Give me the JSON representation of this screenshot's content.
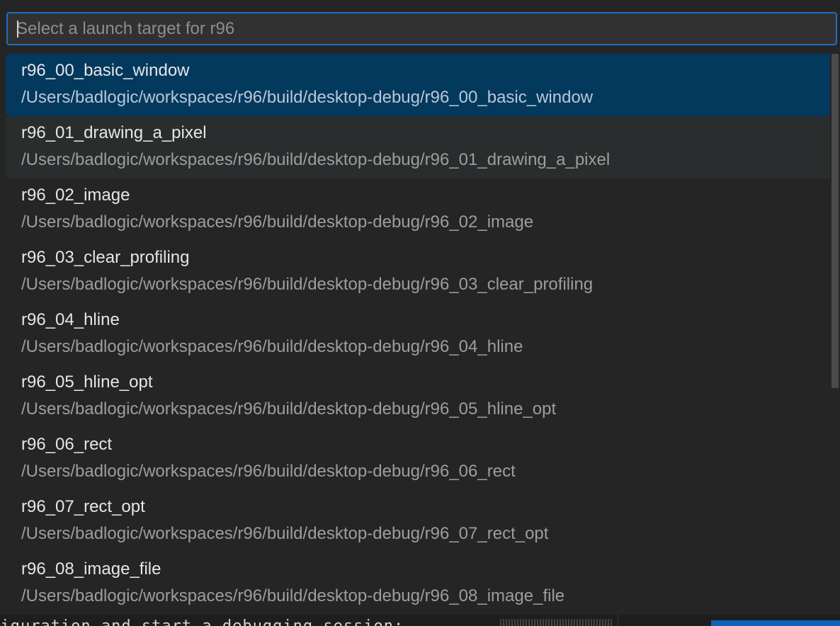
{
  "quick_pick": {
    "input": {
      "value": "",
      "placeholder": "Select a launch target for r96"
    },
    "items": [
      {
        "label": "r96_00_basic_window",
        "description": "/Users/badlogic/workspaces/r96/build/desktop-debug/r96_00_basic_window",
        "state": "selected"
      },
      {
        "label": "r96_01_drawing_a_pixel",
        "description": "/Users/badlogic/workspaces/r96/build/desktop-debug/r96_01_drawing_a_pixel",
        "state": "hover"
      },
      {
        "label": "r96_02_image",
        "description": "/Users/badlogic/workspaces/r96/build/desktop-debug/r96_02_image",
        "state": "normal"
      },
      {
        "label": "r96_03_clear_profiling",
        "description": "/Users/badlogic/workspaces/r96/build/desktop-debug/r96_03_clear_profiling",
        "state": "normal"
      },
      {
        "label": "r96_04_hline",
        "description": "/Users/badlogic/workspaces/r96/build/desktop-debug/r96_04_hline",
        "state": "normal"
      },
      {
        "label": "r96_05_hline_opt",
        "description": "/Users/badlogic/workspaces/r96/build/desktop-debug/r96_05_hline_opt",
        "state": "normal"
      },
      {
        "label": "r96_06_rect",
        "description": "/Users/badlogic/workspaces/r96/build/desktop-debug/r96_06_rect",
        "state": "normal"
      },
      {
        "label": "r96_07_rect_opt",
        "description": "/Users/badlogic/workspaces/r96/build/desktop-debug/r96_07_rect_opt",
        "state": "normal"
      },
      {
        "label": "r96_08_image_file",
        "description": "/Users/badlogic/workspaces/r96/build/desktop-debug/r96_08_image_file",
        "state": "normal"
      }
    ]
  },
  "editor_background": {
    "text": "nfiguration and start a debugging session:"
  },
  "colors": {
    "accent_border": "#1f6fc5",
    "selected_bg": "#04395e",
    "hover_bg": "#2a2d2e",
    "panel_bg": "#252526"
  }
}
